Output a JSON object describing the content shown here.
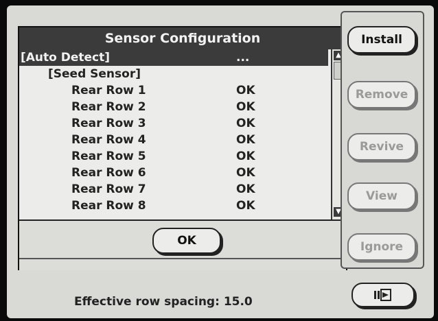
{
  "dialog": {
    "title": "Sensor Configuration",
    "rows": [
      {
        "name": "[Auto Detect]",
        "status": "...",
        "selected": true
      },
      {
        "name": "[Seed Sensor]",
        "status": ""
      },
      {
        "name": "Rear Row 1",
        "status": "OK"
      },
      {
        "name": "Rear Row 2",
        "status": "OK"
      },
      {
        "name": "Rear Row 3",
        "status": "OK"
      },
      {
        "name": "Rear Row 4",
        "status": "OK"
      },
      {
        "name": "Rear Row 5",
        "status": "OK"
      },
      {
        "name": "Rear Row 6",
        "status": "OK"
      },
      {
        "name": "Rear Row 7",
        "status": "OK"
      },
      {
        "name": "Rear Row 8",
        "status": "OK"
      }
    ],
    "ok_label": "OK"
  },
  "side_buttons": [
    {
      "label": "Install",
      "enabled": true
    },
    {
      "label": "Remove",
      "enabled": false
    },
    {
      "label": "Revive",
      "enabled": false
    },
    {
      "label": "View",
      "enabled": false
    },
    {
      "label": "Ignore",
      "enabled": false
    }
  ],
  "footer": {
    "text": "Effective row spacing: 15.0",
    "exit_icon": "exit-door-icon"
  },
  "colors": {
    "background": "#0a0a0a",
    "screen": "#d9d9d6",
    "title_bar": "#3b3b3b",
    "disabled_text": "#9a9a98"
  }
}
